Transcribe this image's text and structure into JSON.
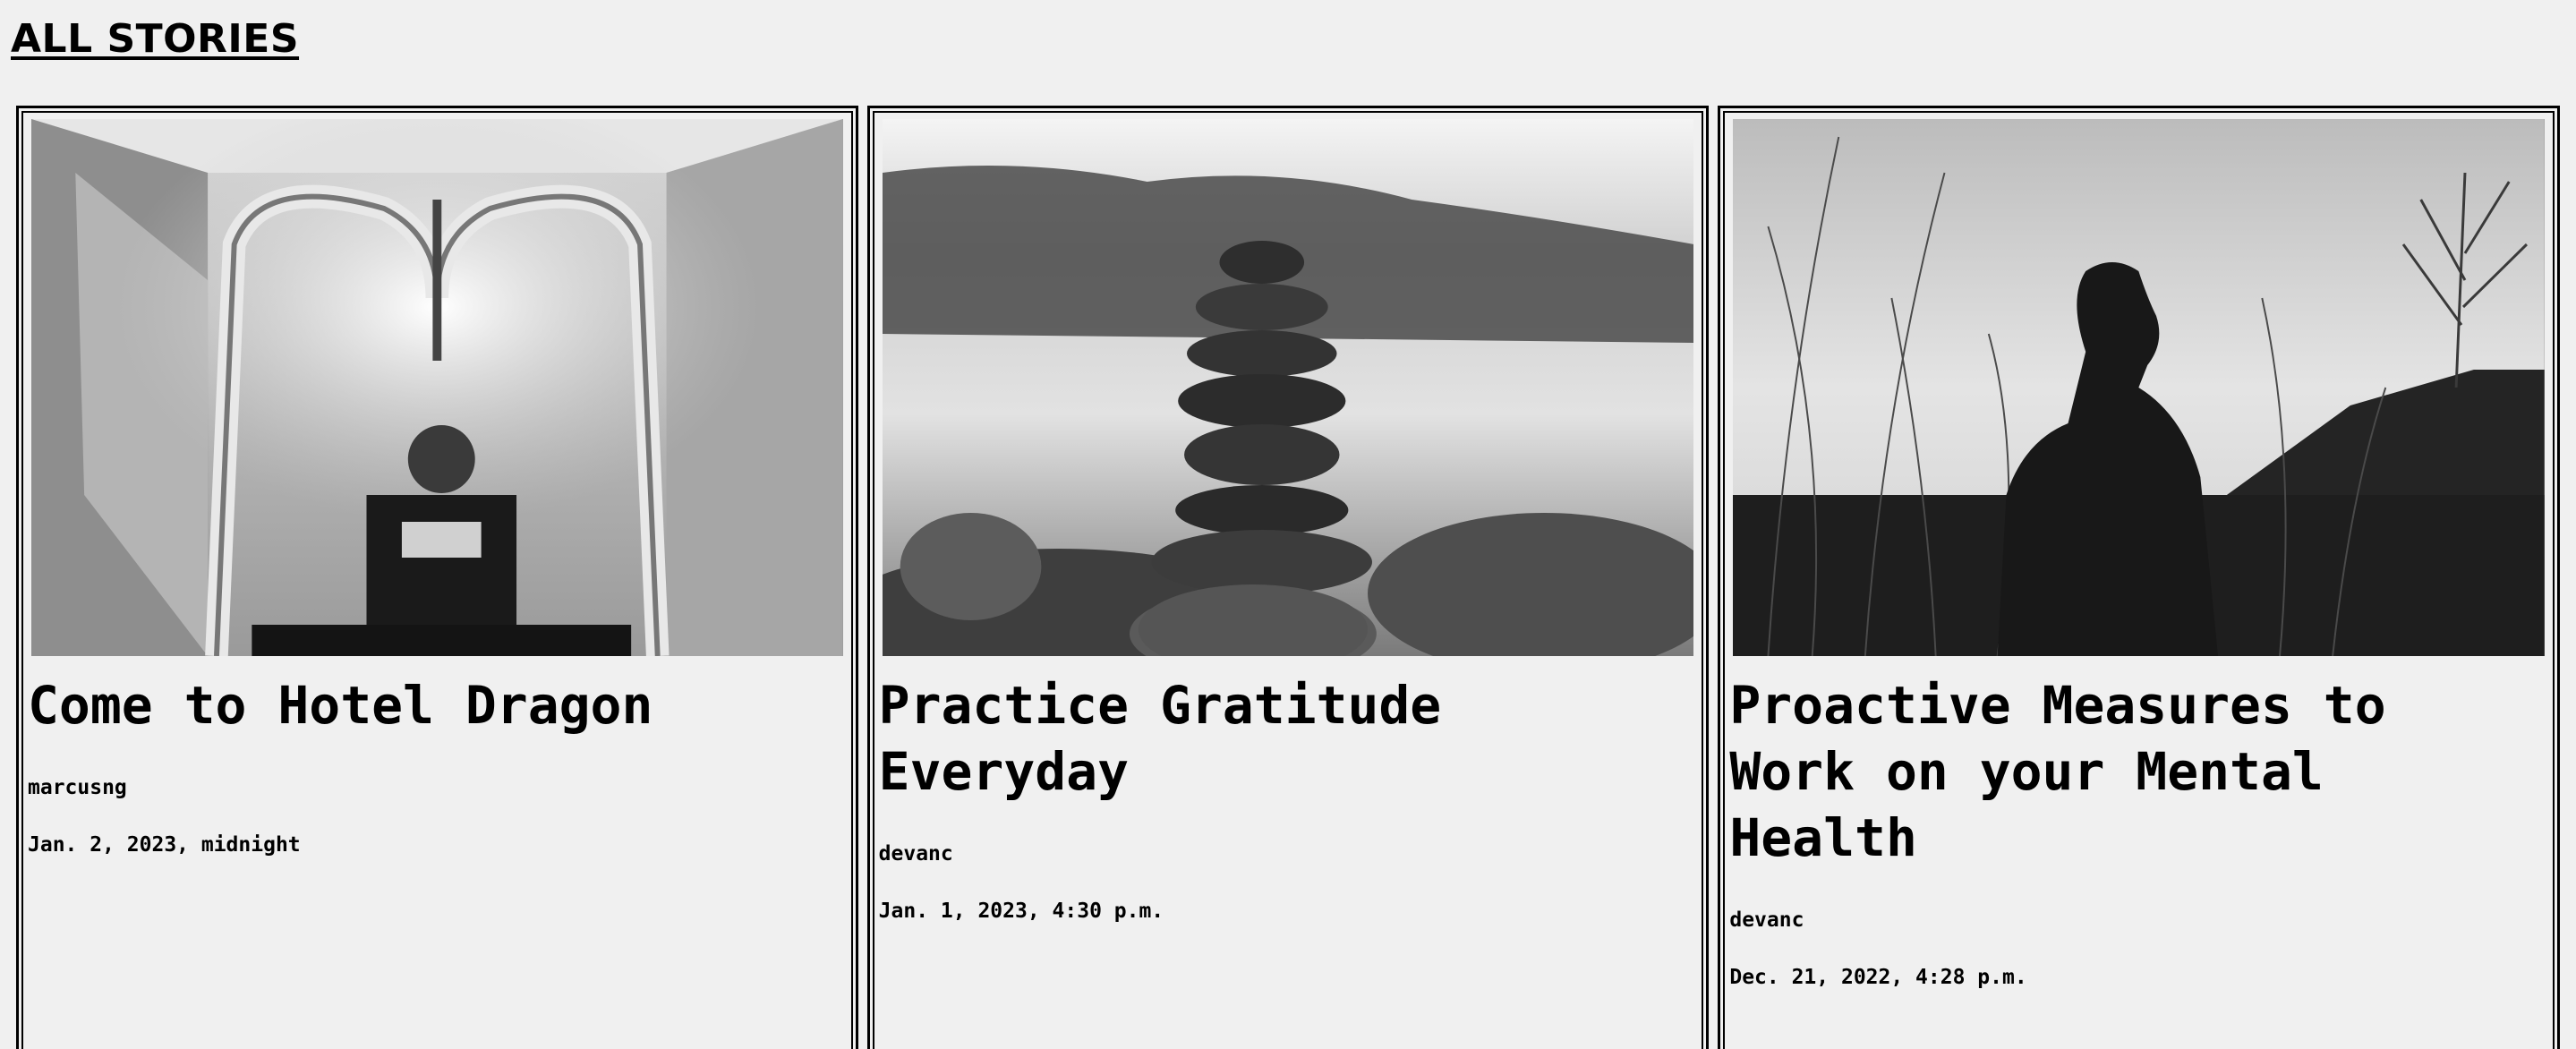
{
  "page": {
    "heading": "ALL STORIES"
  },
  "stories": [
    {
      "title": "Come to Hotel Dragon",
      "author": "marcusng",
      "date": "Jan. 2, 2023, midnight",
      "image_icon": "bellman-cart-photo"
    },
    {
      "title": "Practice Gratitude Everyday",
      "author": "devanc",
      "date": "Jan. 1, 2023, 4:30 p.m.",
      "image_icon": "stacked-stones-photo"
    },
    {
      "title": "Proactive Measures to Work on your Mental Health",
      "author": "devanc",
      "date": "Dec. 21, 2022, 4:28 p.m.",
      "image_icon": "man-in-grass-silhouette-photo"
    }
  ]
}
